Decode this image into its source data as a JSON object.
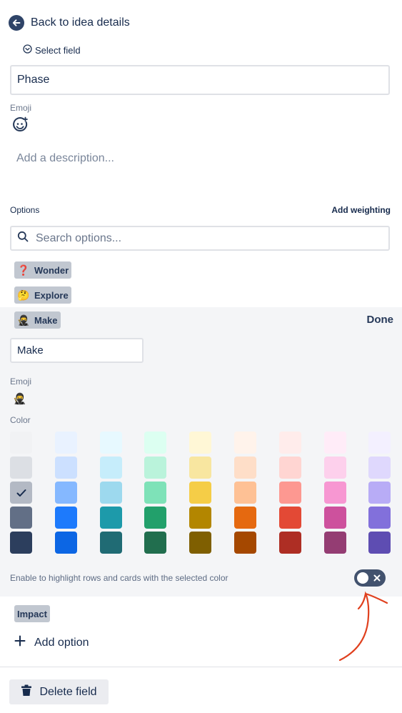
{
  "header": {
    "back_label": "Back to idea details"
  },
  "field": {
    "select_field_label": "Select field",
    "name_value": "Phase",
    "emoji_label": "Emoji",
    "description_placeholder": "Add a description..."
  },
  "options_section": {
    "label": "Options",
    "add_weighting_label": "Add weighting",
    "search_placeholder": "Search options...",
    "items": [
      {
        "emoji": "❓",
        "label": "Wonder"
      },
      {
        "emoji": "🤔",
        "label": "Explore"
      },
      {
        "emoji": "🥷",
        "label": "Make"
      },
      {
        "emoji": "",
        "label": "Impact"
      }
    ]
  },
  "edit_option": {
    "done_label": "Done",
    "name_value": "Make",
    "emoji_label": "Emoji",
    "emoji": "🥷",
    "color_label": "Color",
    "selected_color": "#b3b9c4",
    "colors": [
      [
        "#f1f2f4",
        "#e9f2ff",
        "#e7f9ff",
        "#dcfff1",
        "#fff7d6",
        "#fff3eb",
        "#ffeceb",
        "#ffecf8",
        "#f3f0ff"
      ],
      [
        "#dcdfe4",
        "#cce0ff",
        "#c6edfb",
        "#baf3db",
        "#f8e6a0",
        "#fedec8",
        "#ffd5d2",
        "#fdd0ec",
        "#dfd8fd"
      ],
      [
        "#b3b9c4",
        "#85b8ff",
        "#9dd9ee",
        "#7ee2b8",
        "#f5cd47",
        "#fec195",
        "#fd9891",
        "#f797d2",
        "#b8acf6"
      ],
      [
        "#626f86",
        "#1d7afc",
        "#1d9aaa",
        "#22a06b",
        "#b38600",
        "#e56910",
        "#e34935",
        "#cd519d",
        "#8270db"
      ],
      [
        "#2c3e5d",
        "#0c66e4",
        "#206b74",
        "#216e4e",
        "#7f5f01",
        "#a54800",
        "#ae2e24",
        "#943d73",
        "#5e4db2"
      ]
    ],
    "highlight_text": "Enable to highlight rows and cards with the selected color",
    "highlight_enabled": false
  },
  "footer": {
    "add_option_label": "Add option",
    "delete_field_label": "Delete field"
  },
  "colors": {
    "toggle_off": "#42526e",
    "annotation": "#e0401e"
  }
}
